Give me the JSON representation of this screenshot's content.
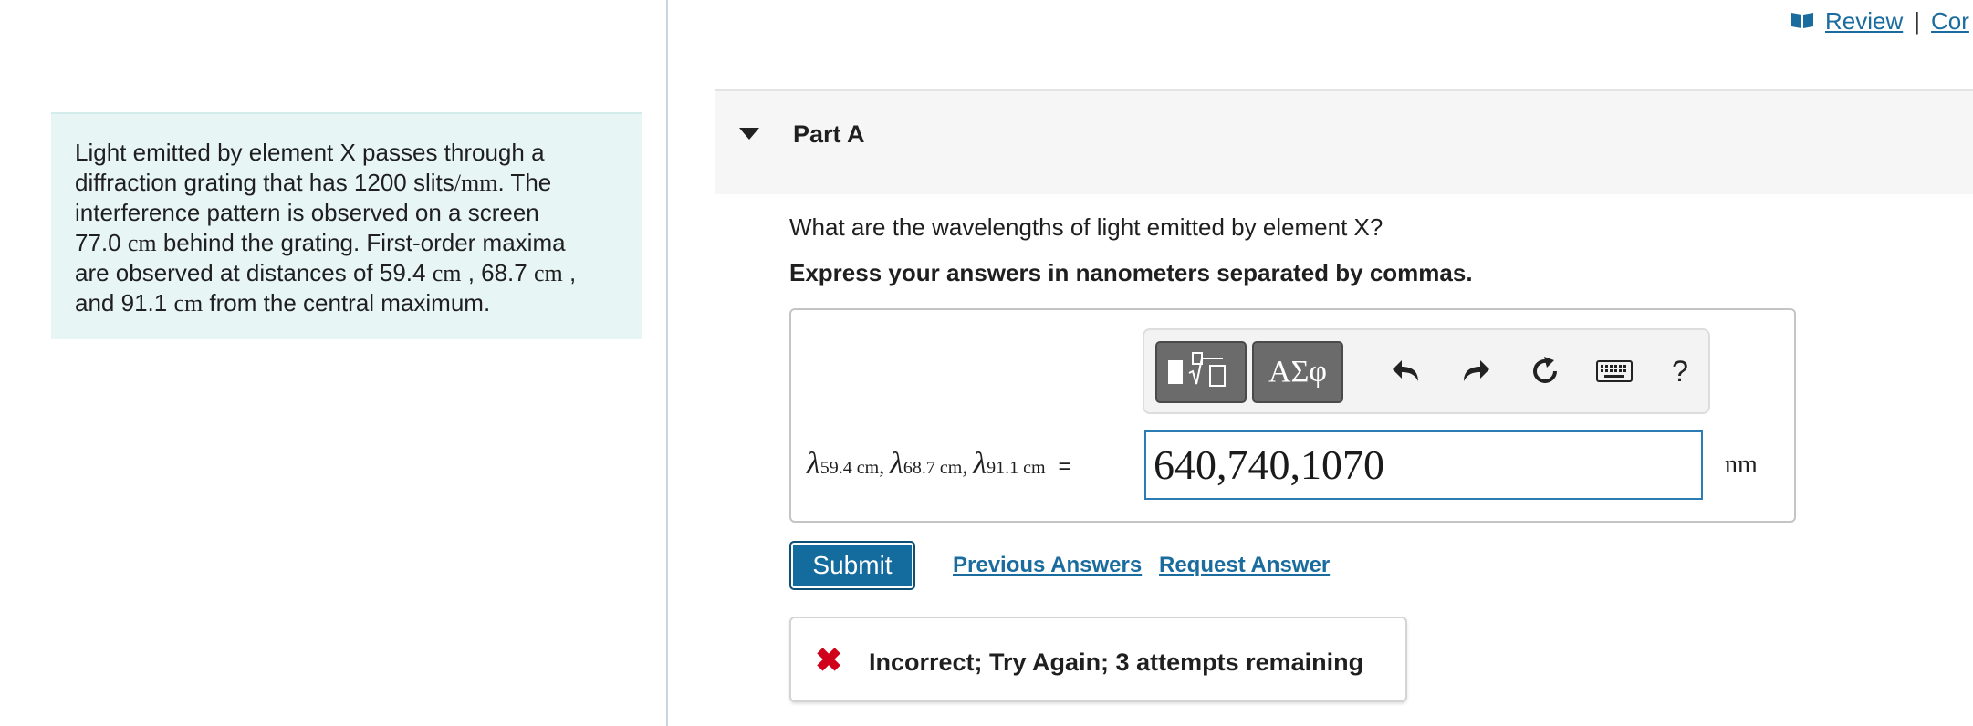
{
  "header": {
    "review_label": "Review",
    "separator": "|",
    "constants_label": "Cor"
  },
  "problem": {
    "text_1": "Light emitted by element X passes through a",
    "text_2a": "diffraction grating that has 1200 slits",
    "text_2b": "/mm",
    "text_2c": ". The",
    "text_3": "interference pattern is observed on a screen",
    "text_4a": "77.0 ",
    "text_4b": "cm",
    "text_4c": " behind the grating. First-order maxima",
    "text_5a": "are observed at distances of 59.4 ",
    "text_5b": "cm",
    "text_5c": " , 68.7 ",
    "text_5d": "cm",
    "text_5e": " ,",
    "text_6a": "and 91.1 ",
    "text_6b": "cm",
    "text_6c": " from the central maximum."
  },
  "part": {
    "title": "Part A",
    "question": "What are the wavelengths of light emitted by element X?",
    "instruction": "Express your answers in nanometers separated by commas."
  },
  "toolbar": {
    "templates_icon": "templates-icon",
    "greek_label": "ΑΣφ",
    "undo_icon": "undo-icon",
    "redo_icon": "redo-icon",
    "reset_icon": "reset-icon",
    "keyboard_icon": "keyboard-icon",
    "help_label": "?"
  },
  "answer": {
    "lambda": "λ",
    "sub_1": "59.4 cm",
    "sub_2": "68.7 cm",
    "sub_3": "91.1 cm",
    "comma": ",",
    "equals": "=",
    "value": "640,740,1070",
    "unit": "nm"
  },
  "actions": {
    "submit_label": "Submit",
    "previous_answers_label": "Previous Answers",
    "request_answer_label": "Request Answer"
  },
  "feedback": {
    "icon": "x-icon",
    "icon_glyph": "✖",
    "text": "Incorrect; Try Again; 3 attempts remaining",
    "color": "#d0021b"
  },
  "colors": {
    "accent": "#136b9e",
    "link": "#1a6c9e",
    "problem_bg": "#e8f5f5"
  }
}
